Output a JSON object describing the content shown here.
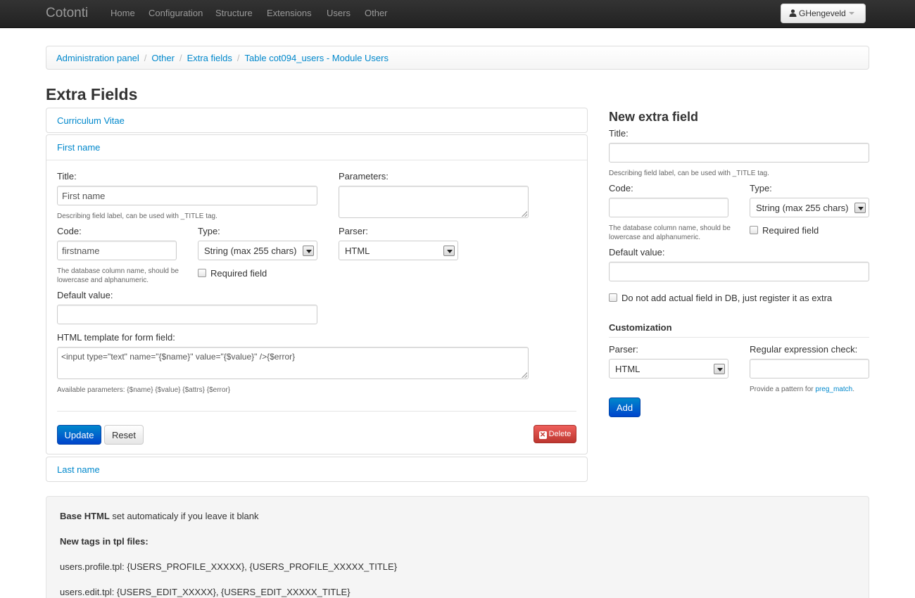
{
  "navbar": {
    "brand": "Cotonti",
    "items": [
      "Home",
      "Configuration",
      "Structure",
      "Extensions",
      "Users",
      "Other"
    ],
    "user": "GHengeveld"
  },
  "breadcrumb": [
    "Administration panel",
    "Other",
    "Extra fields",
    "Table cot094_users - Module Users"
  ],
  "page_title": "Extra Fields",
  "fields": {
    "cv_title": "Curriculum Vitae",
    "first_name_title": "First name",
    "last_name_title": "Last name"
  },
  "edit_form": {
    "title_label": "Title:",
    "title_value": "First name",
    "title_help": "Describing field label, can be used with _TITLE tag.",
    "params_label": "Parameters:",
    "code_label": "Code:",
    "code_value": "firstname",
    "code_help": "The database column name, should be lowercase and alphanumeric.",
    "type_label": "Type:",
    "type_value": "String (max 255 chars)",
    "required_label": "Required field",
    "parser_label": "Parser:",
    "parser_value": "HTML",
    "default_label": "Default value:",
    "template_label": "HTML template for form field:",
    "template_value": "<input type=\"text\" name=\"{$name}\" value=\"{$value}\"  />{$error}",
    "template_help": "Available parameters: {$name} {$value} {$attrs} {$error}",
    "update_button": "Update",
    "reset_button": "Reset",
    "delete_button": "Delete"
  },
  "new_field": {
    "heading": "New extra field",
    "title_label": "Title:",
    "title_help": "Describing field label, can be used with _TITLE tag.",
    "code_label": "Code:",
    "code_help": "The database column name, should be lowercase and alphanumeric.",
    "type_label": "Type:",
    "type_value": "String (max 255 chars)",
    "required_label": "Required field",
    "default_label": "Default value:",
    "noalter_label": "Do not add actual field in DB, just register it as extra",
    "customization_heading": "Customization",
    "parser_label": "Parser:",
    "parser_value": "HTML",
    "regex_label": "Regular expression check:",
    "regex_help_prefix": "Provide a pattern for ",
    "regex_help_link": "preg_match",
    "regex_help_suffix": ".",
    "add_button": "Add"
  },
  "info": {
    "base_html_bold": "Base HTML",
    "base_html_rest": " set automaticaly if you leave it blank",
    "new_tags_heading": "New tags in tpl files:",
    "profile_line": "users.profile.tpl: {USERS_PROFILE_XXXXX}, {USERS_PROFILE_XXXXX_TITLE}",
    "edit_line": "users.edit.tpl: {USERS_EDIT_XXXXX}, {USERS_EDIT_XXXXX_TITLE}"
  },
  "colors": {
    "link": "#0088cc",
    "primary": "#0055cc",
    "danger": "#da4f49",
    "navbar": "#2a2a2a"
  }
}
